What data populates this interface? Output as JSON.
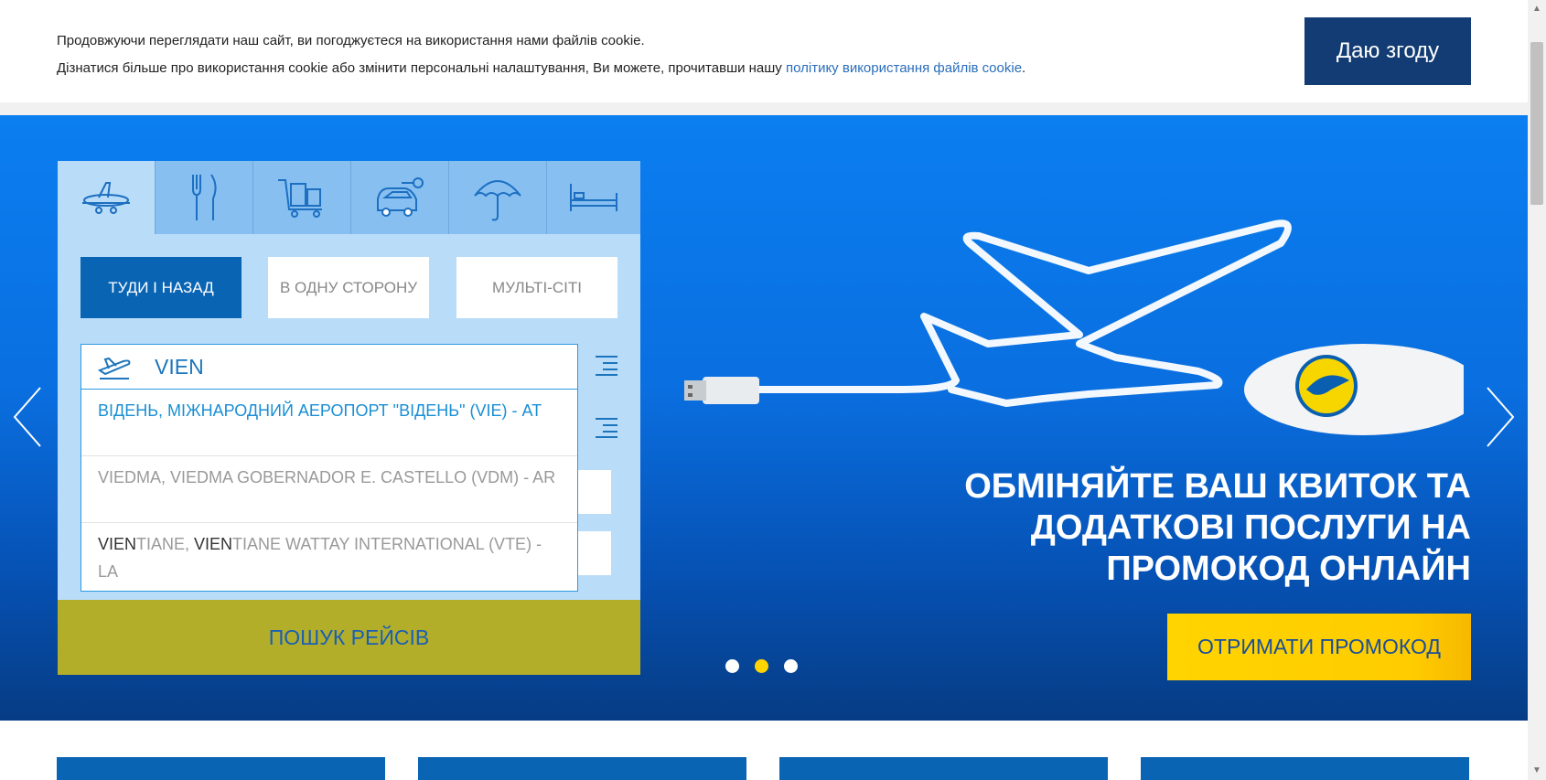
{
  "cookie": {
    "line1": "Продовжуючи переглядати наш сайт, ви погоджуєтеся на використання нами файлів cookie.",
    "line2_prefix": "Дізнатися більше про використання cookie або змінити персональні налаштування, Ви можете, прочитавши нашу ",
    "line2_link": "політику використання файлів cookie",
    "line2_suffix": ".",
    "agree_label": "Даю згоду"
  },
  "widget": {
    "tabs": [
      "flights-icon",
      "dining-icon",
      "baggage-icon",
      "car-rental-icon",
      "insurance-icon",
      "hotel-icon"
    ],
    "trip_types": {
      "round": "ТУДИ І НАЗАД",
      "oneway": "В ОДНУ СТОРОНУ",
      "multi": "МУЛЬТІ-СІТІ"
    },
    "origin_value": "VIEN",
    "suggestions": [
      {
        "text": "ВІДЕНЬ,  МІЖНАРОДНИЙ АЕРОПОРТ \"ВІДЕНЬ\"  (VIE) - AT"
      },
      {
        "text": "VIEDMA,  VIEDMA GOBERNADOR E. CASTELLO  (VDM) - AR"
      },
      {
        "match1": "VIEN",
        "rest1": "TIANE,  ",
        "match2": "VIEN",
        "rest2": "TIANE WATTAY INTERNATIONAL (VTE) - LA"
      }
    ],
    "search_label": "ПОШУК РЕЙСІВ"
  },
  "hero": {
    "title_line1": "ОБМІНЯЙТЕ ВАШ КВИТОК ТА",
    "title_line2": "ДОДАТКОВІ ПОСЛУГИ НА",
    "title_line3": "ПРОМОКОД ОНЛАЙН",
    "cta_label": "ОТРИМАТИ ПРОМОКОД",
    "active_slide": 2,
    "slide_count": 3
  },
  "colors": {
    "accent_dark": "#123c73",
    "accent_blue": "#0a64b4",
    "search_button": "#b3ae2a",
    "promo_yellow": "#ffd400"
  }
}
